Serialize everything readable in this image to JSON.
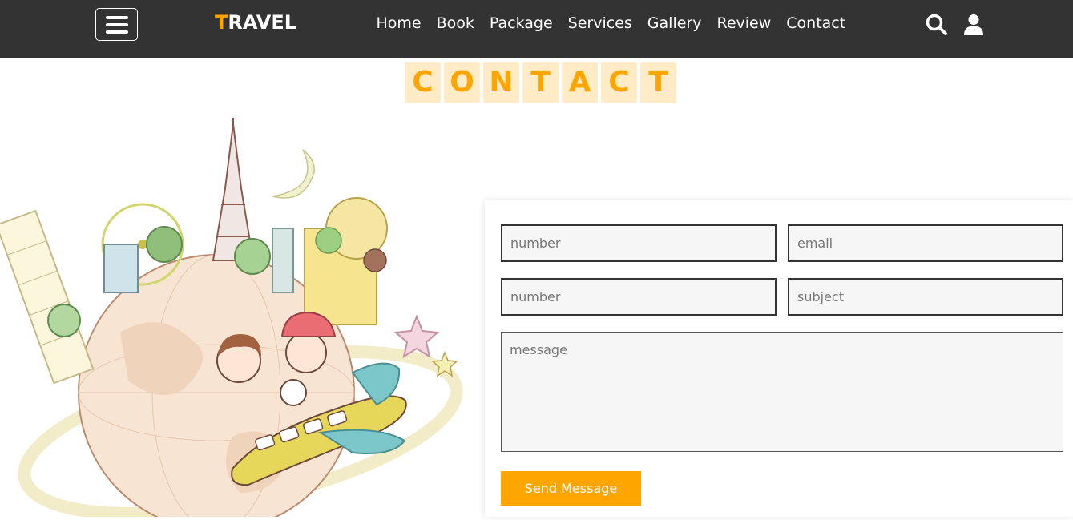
{
  "header": {
    "logo_first": "T",
    "logo_rest": "RAVEL",
    "nav": [
      "Home",
      "Book",
      "Package",
      "Services",
      "Gallery",
      "Review",
      "Contact"
    ],
    "icons": {
      "menu": "hamburger-icon",
      "search": "search-icon",
      "user": "user-icon"
    }
  },
  "section": {
    "title_letters": [
      "C",
      "O",
      "N",
      "T",
      "A",
      "C",
      "T"
    ]
  },
  "form": {
    "placeholder_1": "number",
    "placeholder_2": "email",
    "placeholder_3": "number",
    "placeholder_4": "subject",
    "message_placeholder": "message",
    "submit_label": "Send Message"
  },
  "colors": {
    "accent": "#ffa500",
    "header_bg": "#333333",
    "title_tile_bg": "#ffebc6"
  }
}
